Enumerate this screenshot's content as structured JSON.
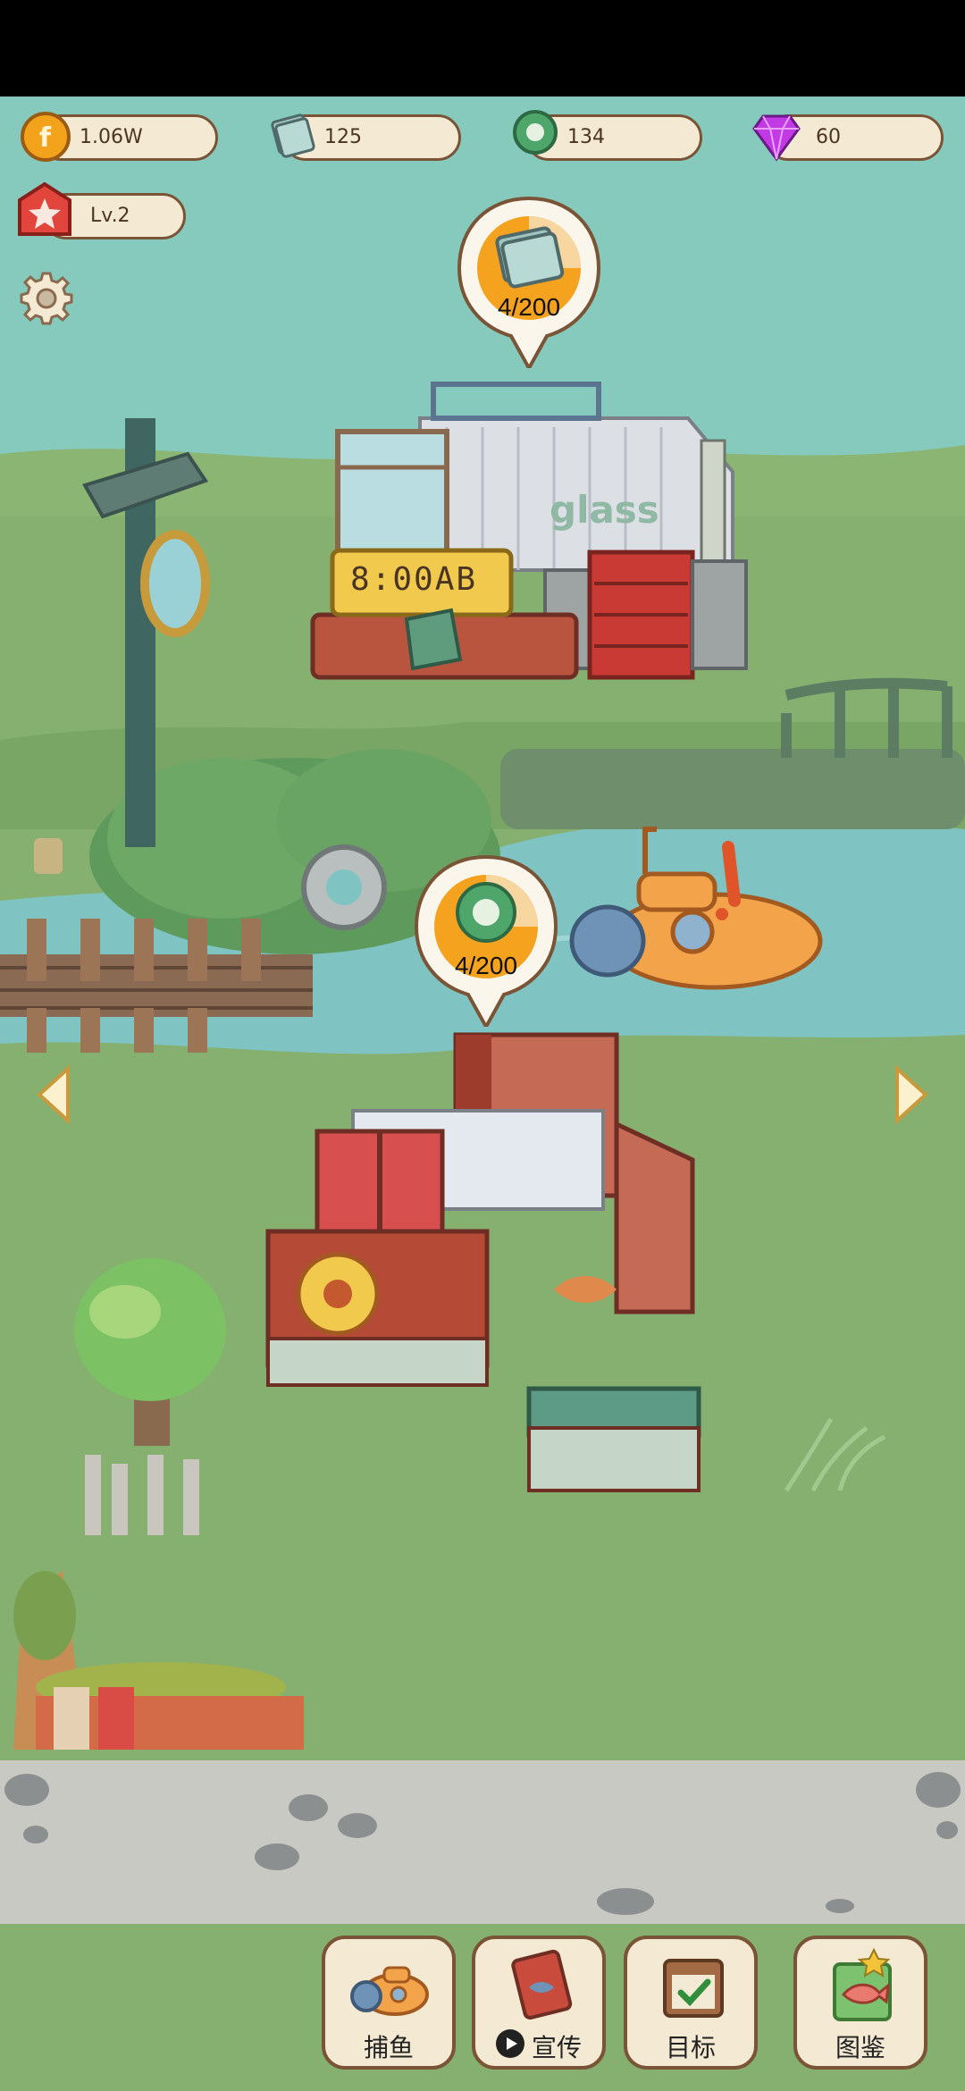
{
  "resources": {
    "coins": {
      "value": "1.06W",
      "icon": "coin-icon",
      "color": "#f3a21c"
    },
    "glass": {
      "value": "125",
      "icon": "glass-pane-icon",
      "color": "#9fc5c1"
    },
    "rubber": {
      "value": "134",
      "icon": "green-ring-icon",
      "color": "#4fa66b"
    },
    "gems": {
      "value": "60",
      "icon": "purple-gem-icon",
      "color": "#c23ae6"
    }
  },
  "level": {
    "value": "Lv.2",
    "icon": "red-star-icon"
  },
  "settings": {
    "icon": "gear-icon"
  },
  "factory_top": {
    "building_label": "glass",
    "sign_text": "8:00AB",
    "progress": "4/200",
    "progress_fraction": 0.02
  },
  "factory_bottom": {
    "progress": "4/200",
    "progress_fraction": 0.02
  },
  "nav": {
    "left_arrow": "chevron-left-icon",
    "right_arrow": "chevron-right-icon"
  },
  "bottom_buttons": [
    {
      "label": "捕鱼",
      "icon": "submarine-icon"
    },
    {
      "label": "宣传",
      "icon": "play-icon"
    },
    {
      "label": "目标",
      "icon": "clipboard-check-icon"
    },
    {
      "label": "图鉴",
      "icon": "fish-book-icon"
    }
  ],
  "colors": {
    "sky": "#86c9bd",
    "grass": "#86b070",
    "water": "#7fc3c2",
    "road": "#c9c9c3",
    "panel_border": "#7a5436",
    "panel_fill": "#f4ead3"
  }
}
